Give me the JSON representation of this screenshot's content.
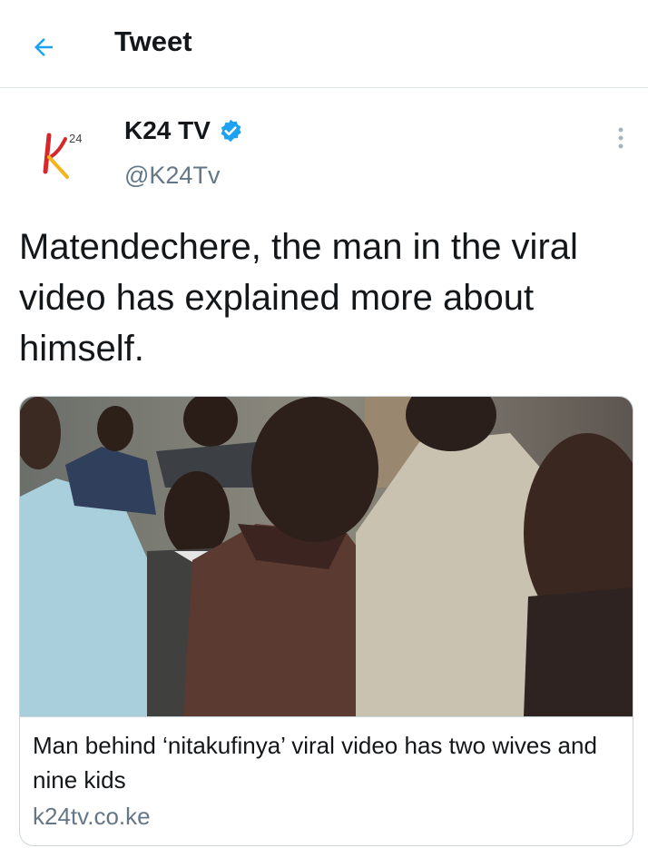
{
  "header": {
    "title": "Tweet",
    "back_icon": "arrow-left-icon"
  },
  "colors": {
    "accent": "#1da1f2",
    "text": "#14171a",
    "muted": "#657786",
    "border": "#ccd6dd",
    "logo_red": "#d6272b",
    "logo_yellow": "#f4b41a"
  },
  "author": {
    "name": "K24 TV",
    "handle": "@K24Tv",
    "verified": true,
    "avatar_logo_sup": "24",
    "avatar_icon": "k24-logo-icon"
  },
  "tweet": {
    "text": "Matendechere, the man in the viral video has explained more about himself."
  },
  "card": {
    "title": "Man behind ‘nitakufinya’ viral video has two wives and nine kids",
    "domain": "k24tv.co.ke",
    "image_icon": "news-photo-crowd"
  }
}
